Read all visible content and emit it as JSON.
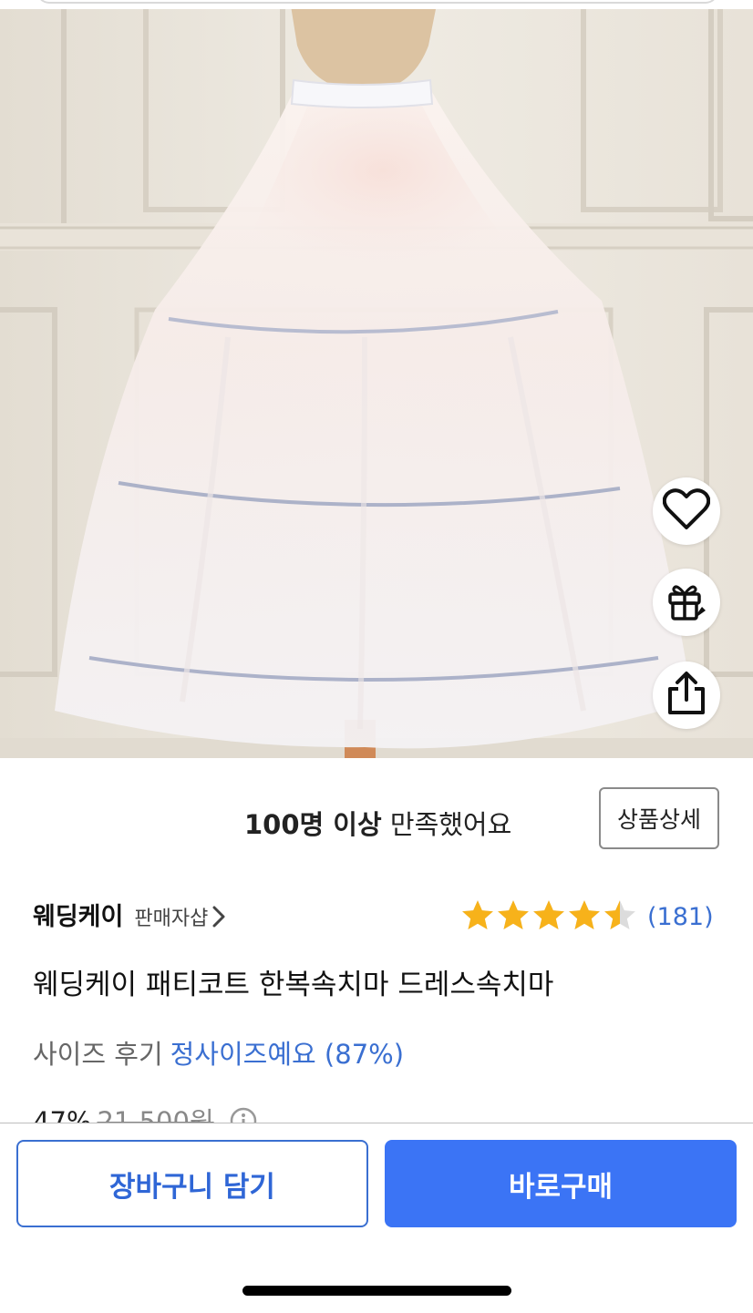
{
  "product_image": {
    "alt": ""
  },
  "actions": {
    "wishlist_icon": "heart-icon",
    "gift_icon": "gift-icon",
    "share_icon": "share-icon"
  },
  "satisfaction": {
    "highlight": "100명 이상",
    "text": " 만족했어요",
    "detail_button": "상품상세"
  },
  "seller": {
    "name": "웨딩케이",
    "shop_link": "판매자샵"
  },
  "rating": {
    "stars": 4.5,
    "max_stars": 5,
    "review_count": "(181)",
    "star_color": "#f7b21a"
  },
  "product": {
    "title": "웨딩케이 패티코트 한복속치마 드레스속치마"
  },
  "size_review": {
    "label": "사이즈 후기",
    "value": "정사이즈예요 (87%)"
  },
  "price": {
    "discount": "47%",
    "original": "21,500원"
  },
  "bottom_bar": {
    "cart_label": "장바구니 담기",
    "buy_label": "바로구매",
    "accent": "#3b74f5"
  }
}
